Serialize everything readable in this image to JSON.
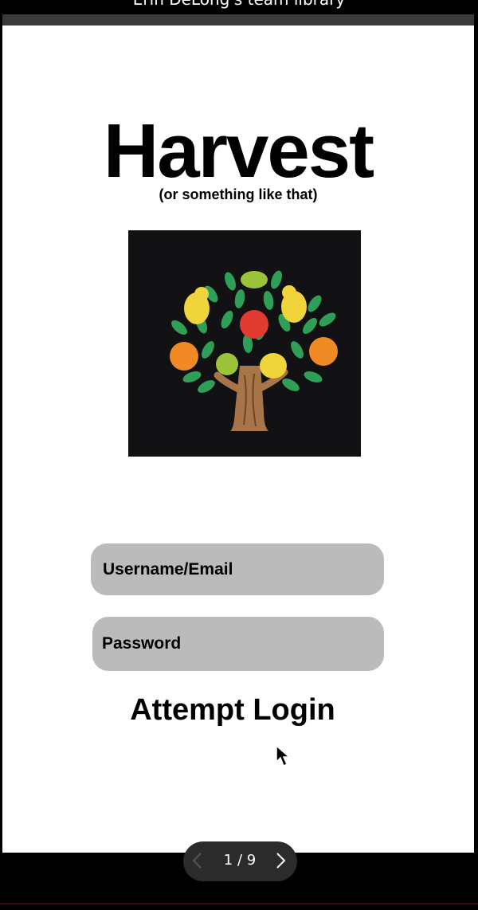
{
  "window": {
    "title": "Erin DeLong's team library"
  },
  "app": {
    "title": "Harvest",
    "subtitle": "(or something like that)"
  },
  "form": {
    "username_label": "Username/Email",
    "password_label": "Password",
    "login_label": "Attempt Login"
  },
  "pager": {
    "text": "1 / 9"
  },
  "colors": {
    "field_bg": "#bbbbbb",
    "logo_bg": "#121113",
    "leaf": "#2f9e57",
    "trunk": "#a8754a",
    "pear": "#f0d43c",
    "apple": "#e23b32",
    "orange": "#f08a24",
    "lime": "#9cc43a"
  },
  "icons": {
    "logo": "fruit-tree-icon",
    "cursor": "mouse-pointer-icon",
    "prev": "chevron-left-icon",
    "next": "chevron-right-icon"
  }
}
